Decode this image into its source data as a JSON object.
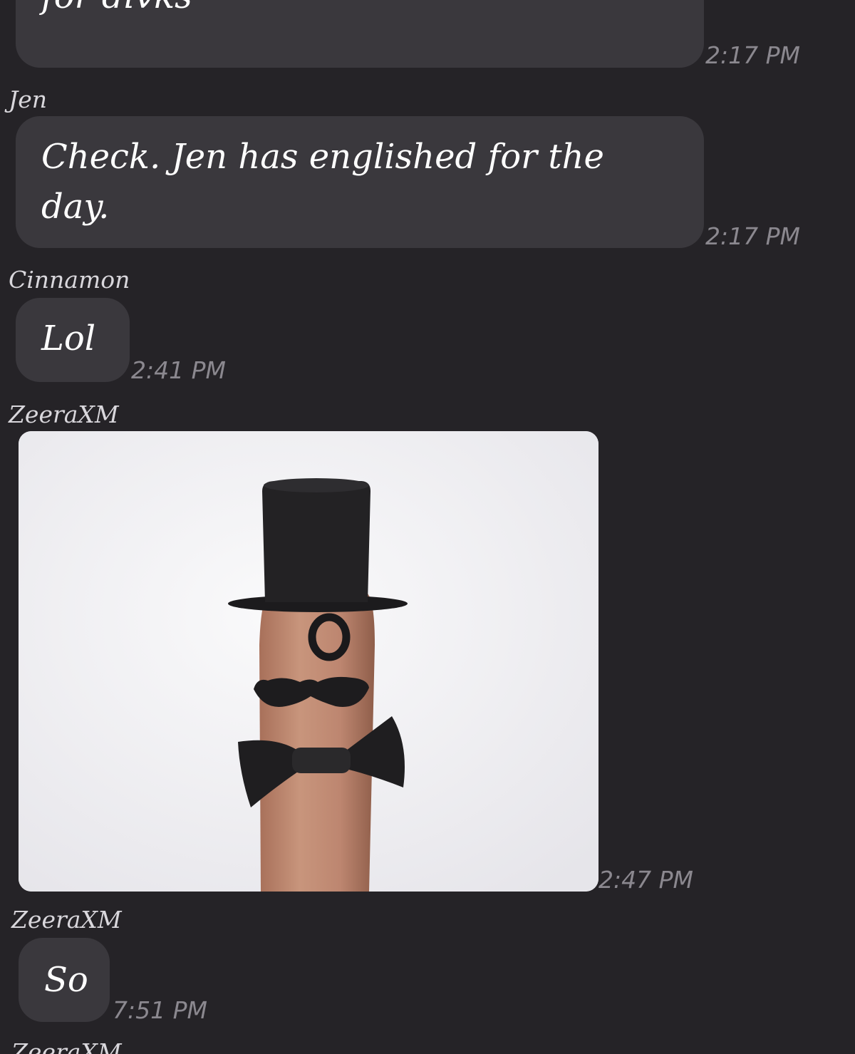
{
  "messages": [
    {
      "sender": "",
      "text": "for divks",
      "time": "2:17 PM"
    },
    {
      "sender": "Jen",
      "text": "Check. Jen has englished for the day.",
      "time": "2:17 PM"
    },
    {
      "sender": "Cinnamon",
      "text": "Lol",
      "time": "2:41 PM"
    },
    {
      "sender": "ZeeraXM",
      "image": "finger-gentleman-photo",
      "time": "2:47 PM"
    },
    {
      "sender": "ZeeraXM",
      "text": "So",
      "time": "7:51 PM"
    },
    {
      "sender": "ZeeraXM"
    }
  ],
  "colors": {
    "background": "#252327",
    "bubble": "#3a383d",
    "timestamp": "#8b888f"
  }
}
